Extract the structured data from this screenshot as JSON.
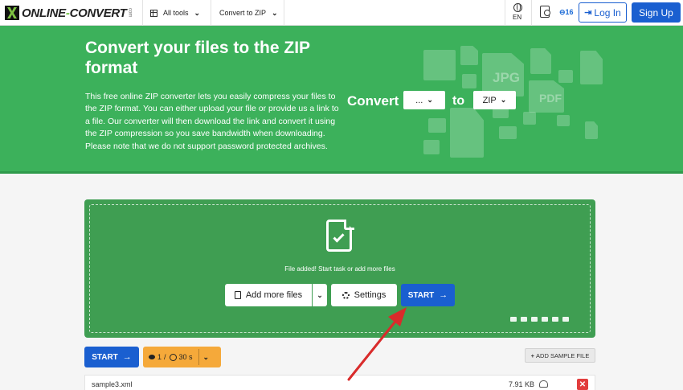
{
  "nav": {
    "logo_main": "ONLINE",
    "logo_dash": "-",
    "logo_tail": "CONVERT",
    "logo_com": "com",
    "all_tools": "All tools",
    "convert_to": "Convert to ZIP",
    "lang": "EN",
    "credits": "16",
    "login": "Log In",
    "signup": "Sign Up"
  },
  "hero": {
    "title": "Convert your files to the ZIP format",
    "description": "This free online ZIP converter lets you easily compress your files to the ZIP format. You can either upload your file or provide us a link to a file. Our converter will then download the link and convert it using the ZIP compression so you save bandwidth when downloading. Please note that we do not support password protected archives.",
    "convert_label": "Convert",
    "from_value": "...",
    "to_label": "to",
    "to_value": "ZIP",
    "bg_icon_labels": [
      "JPG",
      "PDF"
    ]
  },
  "dropzone": {
    "message": "File added! Start task or add more files",
    "add_more": "Add more files",
    "settings": "Settings",
    "start": "START"
  },
  "actions": {
    "start": "START",
    "files_limit": "1",
    "time_limit": "30 s",
    "add_sample": "ADD SAMPLE FILE"
  },
  "files": [
    {
      "name": "sample3.xml",
      "size": "7.91 KB"
    }
  ],
  "colors": {
    "brand_green": "#3cb15b",
    "drop_green": "#3f9e52",
    "primary_blue": "#1a5fd0",
    "limits_orange": "#f5a93a",
    "delete_red": "#e23d3d",
    "annotation_red": "#d92b2b"
  }
}
